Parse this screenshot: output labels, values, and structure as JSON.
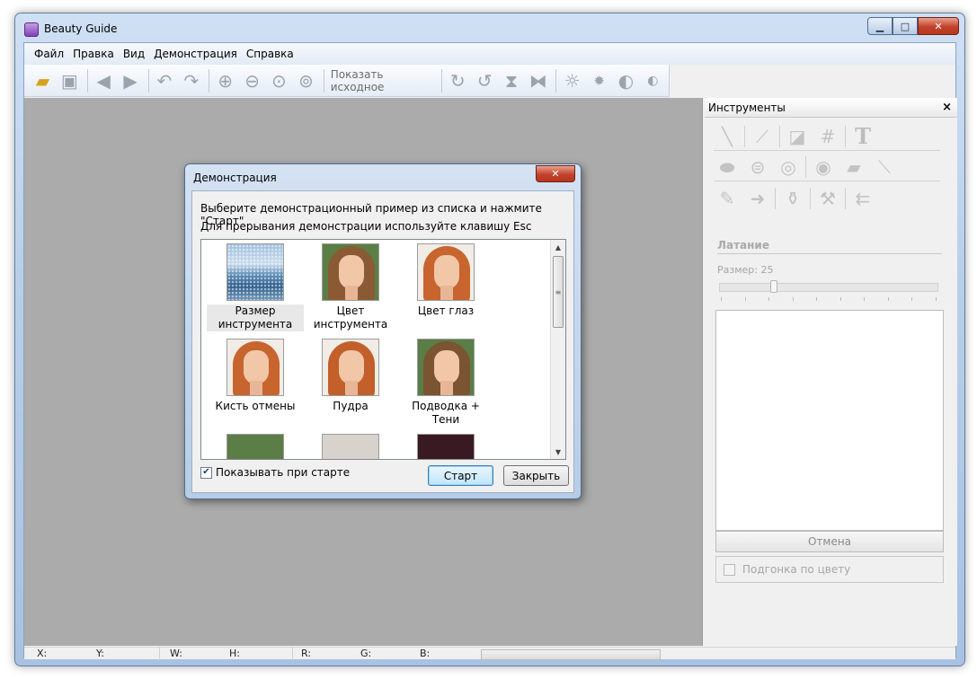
{
  "window": {
    "title": "Beauty Guide"
  },
  "menu": [
    "Файл",
    "Правка",
    "Вид",
    "Демонстрация",
    "Справка"
  ],
  "toolbar": {
    "show_original_label": "Показать исходное",
    "icons": [
      "open-icon",
      "save-icon",
      "back-arrow-icon",
      "forward-arrow-icon",
      "undo-icon",
      "redo-icon",
      "zoom-in-icon",
      "zoom-out-icon",
      "zoom-fit-icon",
      "zoom-actual-icon",
      "rotate-cw-icon",
      "rotate-ccw-icon",
      "flip-vertical-icon",
      "flip-horizontal-icon",
      "brightness-up-icon",
      "brightness-down-icon",
      "contrast-up-icon",
      "contrast-down-icon"
    ]
  },
  "tools_panel": {
    "title": "Инструменты",
    "close_glyph": "×",
    "section_label": "Латание",
    "size_label": "Размер: 25",
    "size_value": 25,
    "cancel_label": "Отмена",
    "color_fit_label": "Подгонка по цвету"
  },
  "status": {
    "x": "X:",
    "y": "Y:",
    "w": "W:",
    "h": "H:",
    "r": "R:",
    "g": "G:",
    "b": "B:"
  },
  "dialog": {
    "title": "Демонстрация",
    "close_glyph": "✕",
    "instruction_1": "Выберите демонстрационный пример из списка и нажмите \"Старт\"",
    "instruction_2": "Для прерывания демонстрации используйте клавишу Esc",
    "examples": [
      {
        "label": "Размер инструмента"
      },
      {
        "label": "Цвет инструмента"
      },
      {
        "label": "Цвет глаз"
      },
      {
        "label": "Кисть отмены"
      },
      {
        "label": "Пудра"
      },
      {
        "label": "Подводка + Тени"
      }
    ],
    "show_at_start_label": "Показывать при старте",
    "show_at_start_checked": true,
    "start_label": "Старт",
    "close_label": "Закрыть"
  }
}
